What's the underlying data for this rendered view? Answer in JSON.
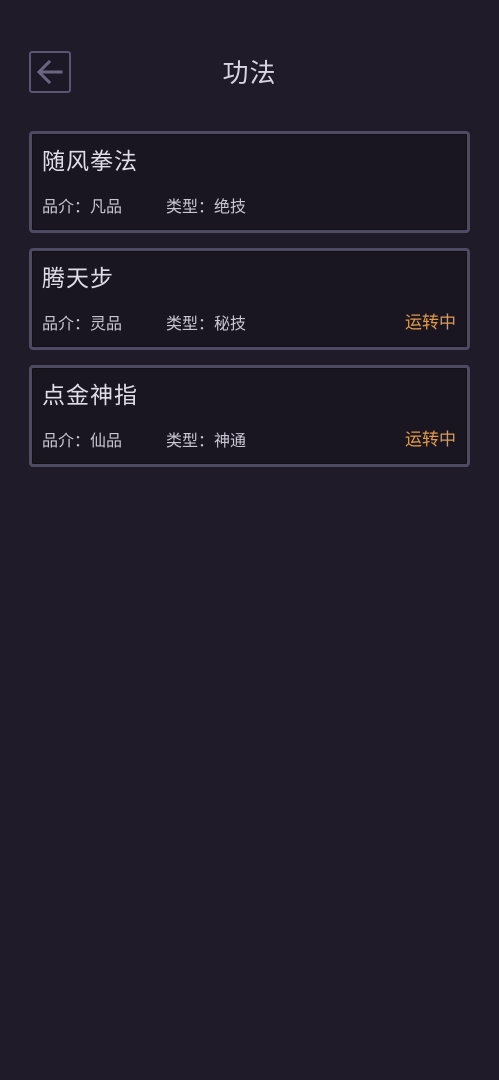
{
  "header": {
    "title": "功法",
    "back_icon": "arrow-left-icon"
  },
  "colors": {
    "background": "#201b29",
    "card_border": "#4e4a63",
    "status_active": "#e09a47"
  },
  "skills": [
    {
      "name": "随风拳法",
      "grade": "品介：凡品",
      "type": "类型：绝技",
      "status": ""
    },
    {
      "name": "腾天步",
      "grade": "品介：灵品",
      "type": "类型：秘技",
      "status": "运转中"
    },
    {
      "name": "点金神指",
      "grade": "品介：仙品",
      "type": "类型：神通",
      "status": "运转中"
    }
  ]
}
